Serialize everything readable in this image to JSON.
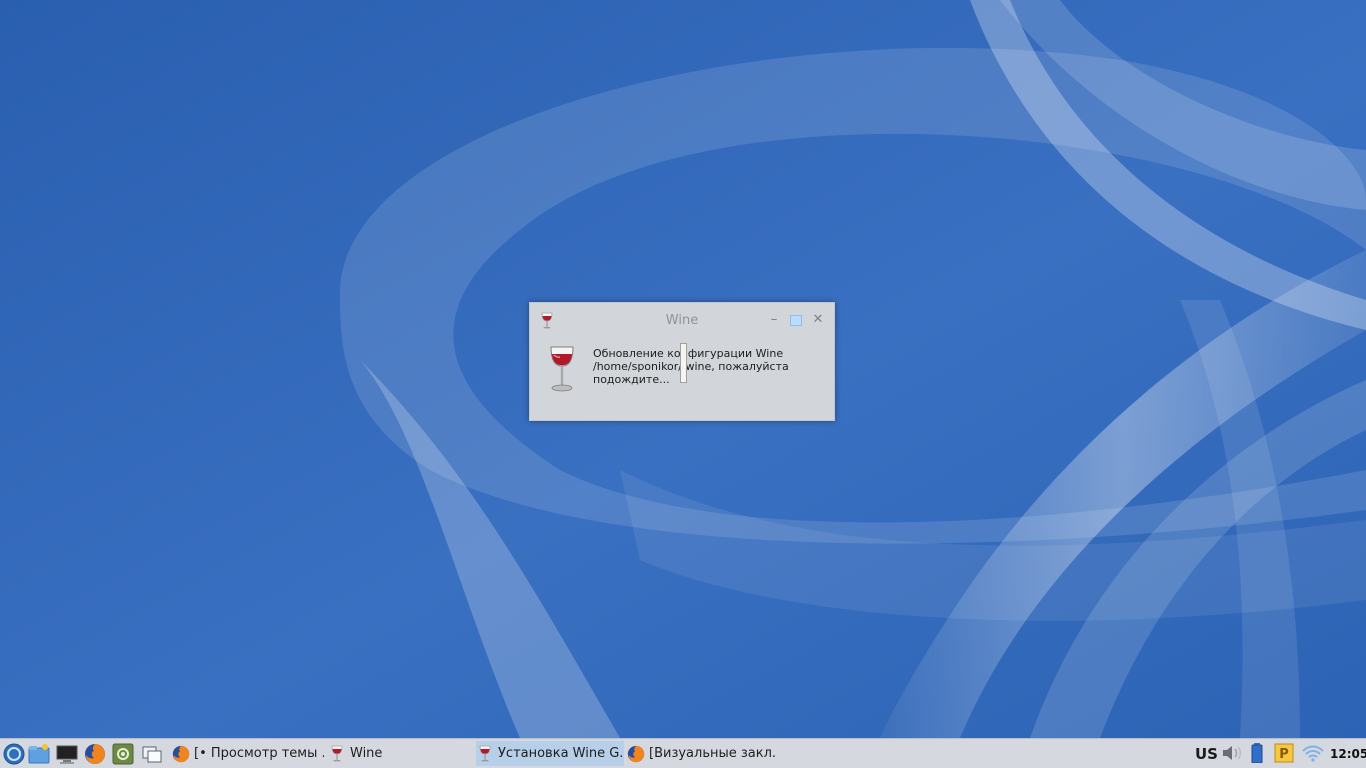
{
  "dialog": {
    "title": "Wine",
    "message": "Обновление конфигурации Wine /home/sponikor/.wine, пожалуйста подождите...",
    "buttons": {
      "minimize": "–",
      "maximize": "□",
      "close": "✕"
    }
  },
  "taskbar": {
    "tasks": [
      {
        "label": "[• Просмотр темы ...",
        "icon": "firefox-icon",
        "active": false
      },
      {
        "label": "Wine",
        "icon": "wine-icon",
        "active": false
      },
      {
        "label": "Установка Wine G...",
        "icon": "wine-icon",
        "active": true
      },
      {
        "label": "[Визуальные закл...",
        "icon": "firefox-icon",
        "active": false
      }
    ],
    "keyboard_layout": "US",
    "clock": "12:05"
  },
  "colors": {
    "desktop_bg": "#2f63b4",
    "taskbar_bg": "#d5d9df",
    "active_task": "#b7cfe8"
  }
}
